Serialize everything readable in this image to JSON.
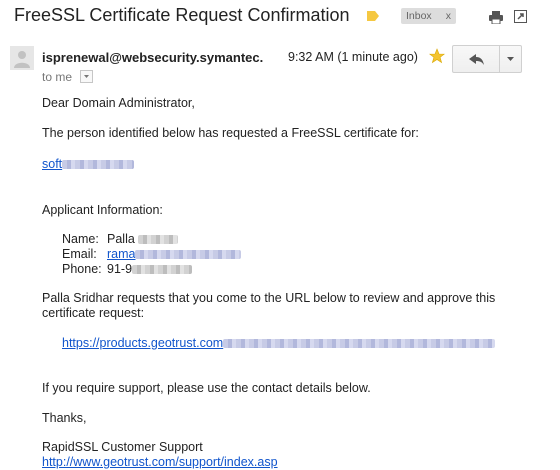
{
  "header": {
    "subject": "FreeSSL Certificate Request Confirmation",
    "label_chip": "Inbox",
    "label_chip_close": "x",
    "icons": [
      "label-tag-icon",
      "print-icon",
      "open-in-new-window-icon"
    ]
  },
  "message": {
    "sender": "isprenewal@websecurity.symantec.",
    "to": "to me",
    "timestamp": "9:32 AM (1 minute ago)",
    "icons": [
      "star-icon",
      "reply-icon",
      "more-dropdown-icon",
      "details-caret-icon"
    ],
    "colors": {
      "star": "#f4c430",
      "label_tag": "#f5c842",
      "link": "#1155cc"
    }
  },
  "body": {
    "greeting": "Dear Domain Administrator,",
    "intro": "The person identified below has requested a FreeSSL certificate for:",
    "domain_visible": "soft",
    "applicant_heading": "Applicant Information:",
    "name_label": "Name:",
    "name_visible": "Palla",
    "email_label": "Email:",
    "email_visible": "rama",
    "phone_label": "Phone:",
    "phone_visible": "91-9",
    "request_line1": "Palla Sridhar requests that you come to the URL below to review and approve this",
    "request_line2": "certificate request:",
    "approval_url_visible": "https://products.geotrust.com",
    "support_line": "If you require support, please use the contact details below.",
    "thanks": "Thanks,",
    "signature": "RapidSSL Customer Support",
    "support_url": "http://www.geotrust.com/support/index.asp"
  }
}
